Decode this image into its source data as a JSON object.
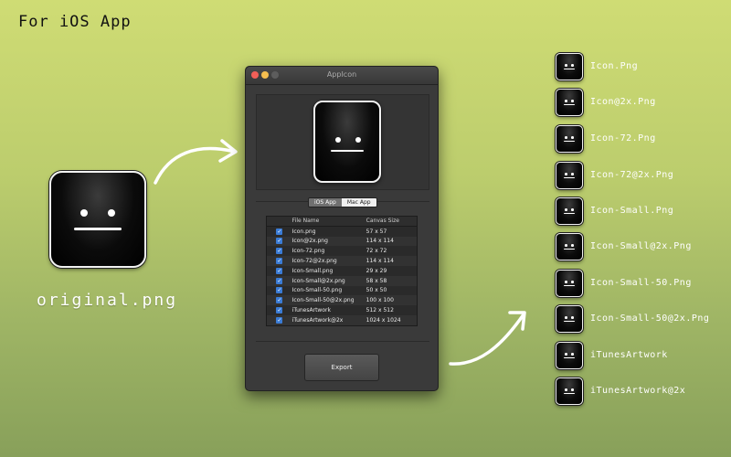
{
  "header": {
    "title": "For iOS App"
  },
  "original": {
    "label": "original.png"
  },
  "window": {
    "title": "AppIcon",
    "segments": {
      "ios": "iOS App",
      "mac": "Mac App"
    },
    "table": {
      "columns": [
        "File Name",
        "Canvas Size"
      ],
      "rows": [
        {
          "name": "Icon.png",
          "size": "57 x 57"
        },
        {
          "name": "Icon@2x.png",
          "size": "114 x 114"
        },
        {
          "name": "Icon-72.png",
          "size": "72 x 72"
        },
        {
          "name": "Icon-72@2x.png",
          "size": "114 x 114"
        },
        {
          "name": "Icon-Small.png",
          "size": "29 x 29"
        },
        {
          "name": "Icon-Small@2x.png",
          "size": "58 x 58"
        },
        {
          "name": "Icon-Small-50.png",
          "size": "50 x 50"
        },
        {
          "name": "Icon-Small-50@2x.png",
          "size": "100 x 100"
        },
        {
          "name": "iTunesArtwork",
          "size": "512 x 512"
        },
        {
          "name": "iTunesArtwork@2x",
          "size": "1024 x 1024"
        }
      ],
      "check_glyph": "✓"
    },
    "export_label": "Export"
  },
  "outputs": [
    "Icon.Png",
    "Icon@2x.Png",
    "Icon-72.Png",
    "Icon-72@2x.Png",
    "Icon-Small.Png",
    "Icon-Small@2x.Png",
    "Icon-Small-50.Png",
    "Icon-Small-50@2x.Png",
    "iTunesArtwork",
    "iTunesArtwork@2x"
  ],
  "colors": {
    "background_top": "#cfdc74",
    "background_bottom": "#88a05a",
    "check": "#3a7bd5"
  }
}
